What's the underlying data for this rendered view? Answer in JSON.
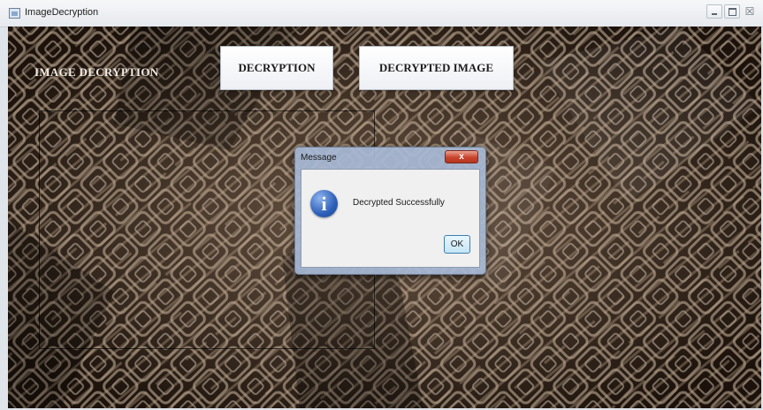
{
  "window": {
    "title": "ImageDecryption",
    "controls": {
      "close_glyph": "☒"
    }
  },
  "app": {
    "title": "IMAGE DECRYPTION",
    "buttons": {
      "decryption": "DECRYPTION",
      "decrypted_image": "DECRYPTED IMAGE"
    }
  },
  "dialog": {
    "title": "Message",
    "close_glyph": "x",
    "icon": "info-icon",
    "icon_glyph": "i",
    "message": "Decrypted Successfully",
    "ok_label": "OK"
  },
  "colors": {
    "background_dark": "#2a1a10",
    "maze_light": "#d9c7b2",
    "dialog_frame": "#a8bad6",
    "close_button": "#c9442c"
  }
}
